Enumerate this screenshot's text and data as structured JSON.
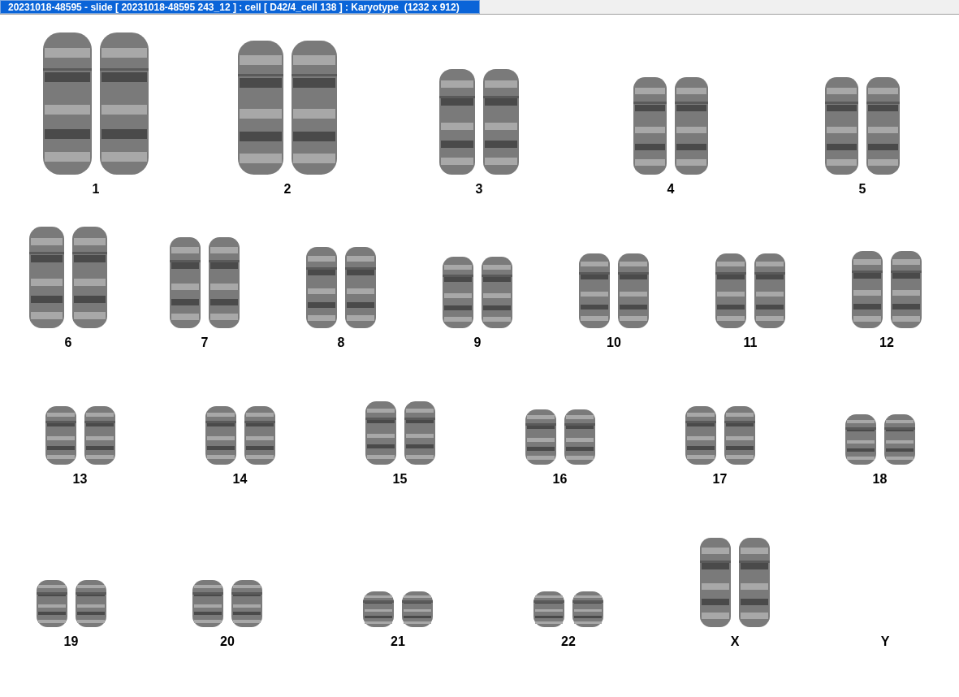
{
  "window": {
    "title": "20231018-48595 - slide [ 20231018-48595 243_12 ] : cell [ D42/4_cell 138 ] : Karyotype  (1232 x 912)"
  },
  "karyotype": {
    "rows": [
      {
        "groups": [
          {
            "label": "1",
            "kind": "pair"
          },
          {
            "label": "2",
            "kind": "pair"
          },
          {
            "label": "3",
            "kind": "pair"
          },
          {
            "label": "4",
            "kind": "pair"
          },
          {
            "label": "5",
            "kind": "pair"
          }
        ]
      },
      {
        "groups": [
          {
            "label": "6",
            "kind": "pair"
          },
          {
            "label": "7",
            "kind": "pair"
          },
          {
            "label": "8",
            "kind": "pair"
          },
          {
            "label": "9",
            "kind": "pair"
          },
          {
            "label": "10",
            "kind": "pair"
          },
          {
            "label": "11",
            "kind": "pair"
          },
          {
            "label": "12",
            "kind": "pair"
          }
        ]
      },
      {
        "groups": [
          {
            "label": "13",
            "kind": "pair"
          },
          {
            "label": "14",
            "kind": "pair"
          },
          {
            "label": "15",
            "kind": "pair"
          },
          {
            "label": "16",
            "kind": "pair"
          },
          {
            "label": "17",
            "kind": "pair"
          },
          {
            "label": "18",
            "kind": "pair"
          }
        ]
      },
      {
        "groups": [
          {
            "label": "19",
            "kind": "pair"
          },
          {
            "label": "20",
            "kind": "pair"
          },
          {
            "label": "21",
            "kind": "pair"
          },
          {
            "label": "22",
            "kind": "pair"
          },
          {
            "label": "X",
            "kind": "pair"
          },
          {
            "label": "Y",
            "kind": "empty"
          }
        ]
      }
    ]
  }
}
